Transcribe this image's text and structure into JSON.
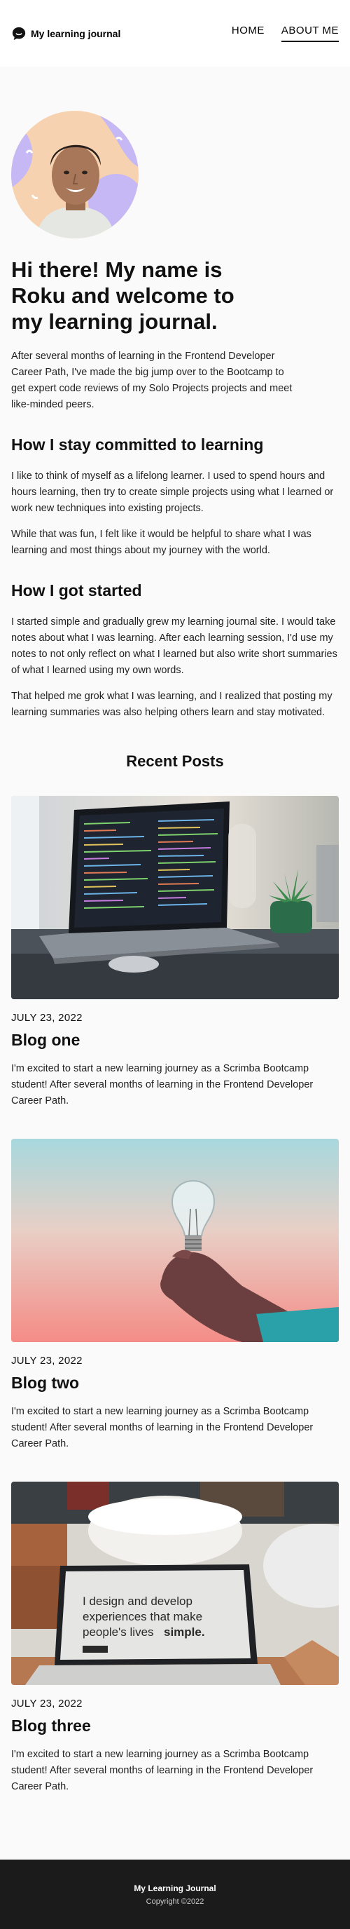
{
  "header": {
    "brand": "My learning journal",
    "nav": [
      {
        "label": "HOME"
      },
      {
        "label": "ABOUT ME"
      }
    ]
  },
  "about": {
    "title": "Hi there! My name is Roku and welcome to my learning journal.",
    "intro": "After several months of learning in the Frontend Developer Career Path, I've made the big jump over to the Bootcamp to get expert code reviews of my Solo Projects projects and meet like-minded peers."
  },
  "sections": [
    {
      "heading": "How I stay committed to learning",
      "paragraphs": [
        "I like to think of myself as a lifelong learner. I used to spend hours and hours learning, then try to create simple projects using what I learned or work new techniques into existing projects.",
        "While that was fun, I felt like it would be helpful to share what I was learning and most things about my journey with the world."
      ]
    },
    {
      "heading": "How I got started",
      "paragraphs": [
        "I started simple and gradually grew my learning journal site. I would take notes about what I was learning. After each learning session, I'd use my notes to not only reflect on what I learned but also write short summaries of what I learned using my own words.",
        "That helped me grok what I was learning, and I realized that posting my learning summaries was also helping others learn and stay motivated."
      ]
    }
  ],
  "recent": {
    "title": "Recent Posts",
    "posts": [
      {
        "date": "JULY 23, 2022",
        "title": "Blog one",
        "excerpt": "I'm excited to start a new learning journey as a Scrimba Bootcamp student! After several months of learning in the Frontend Developer Career Path.",
        "image": "laptop-code-photo"
      },
      {
        "date": "JULY 23, 2022",
        "title": "Blog two",
        "excerpt": "I'm excited to start a new learning journey as a Scrimba Bootcamp student! After several months of learning in the Frontend Developer Career Path.",
        "image": "lightbulb-photo"
      },
      {
        "date": "JULY 23, 2022",
        "title": "Blog three",
        "excerpt": "I'm excited to start a new learning journey as a Scrimba Bootcamp student! After several months of learning in the Frontend Developer Career Path.",
        "image": "laptop-design-photo",
        "screen_text": [
          "I design and develop",
          "experiences that make",
          "people's lives",
          "simple."
        ]
      }
    ]
  },
  "footer": {
    "title": "My Learning Journal",
    "copyright": "Copyright ©2022"
  }
}
